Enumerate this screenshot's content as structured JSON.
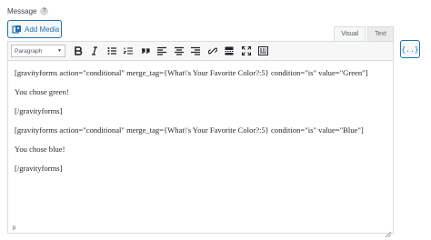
{
  "field": {
    "label": "Message",
    "help_glyph": "?"
  },
  "add_media": {
    "label": "Add Media"
  },
  "tabs": [
    {
      "label": "Visual",
      "active": true
    },
    {
      "label": "Text",
      "active": false
    }
  ],
  "merge_tag_button": {
    "label": "{..}"
  },
  "toolbar": {
    "format_select": {
      "selected": "Paragraph"
    },
    "buttons": [
      "bold-icon",
      "italic-icon",
      "bullet-list-icon",
      "numbered-list-icon",
      "blockquote-icon",
      "align-left-icon",
      "align-center-icon",
      "align-right-icon",
      "link-icon",
      "read-more-icon",
      "fullscreen-icon",
      "toolbar-toggle-icon"
    ]
  },
  "content": {
    "paragraphs": [
      "[gravityforms action=\"conditional\" merge_tag={What\\'s Your Favorite Color?:5} condition=\"is\" value=\"Green\"]",
      "You chose green!",
      "[/gravityforms]",
      "[gravityforms action=\"conditional\" merge_tag={What\\'s Your Favorite Color?:5} condition=\"is\" value=\"Blue\"]",
      "You chose blue!",
      "[/gravityforms]"
    ]
  },
  "statusbar": {
    "path": "p"
  },
  "colors": {
    "accent": "#2271b1",
    "border": "#dcdcde",
    "toolbar_bg": "#f6f7f7"
  }
}
